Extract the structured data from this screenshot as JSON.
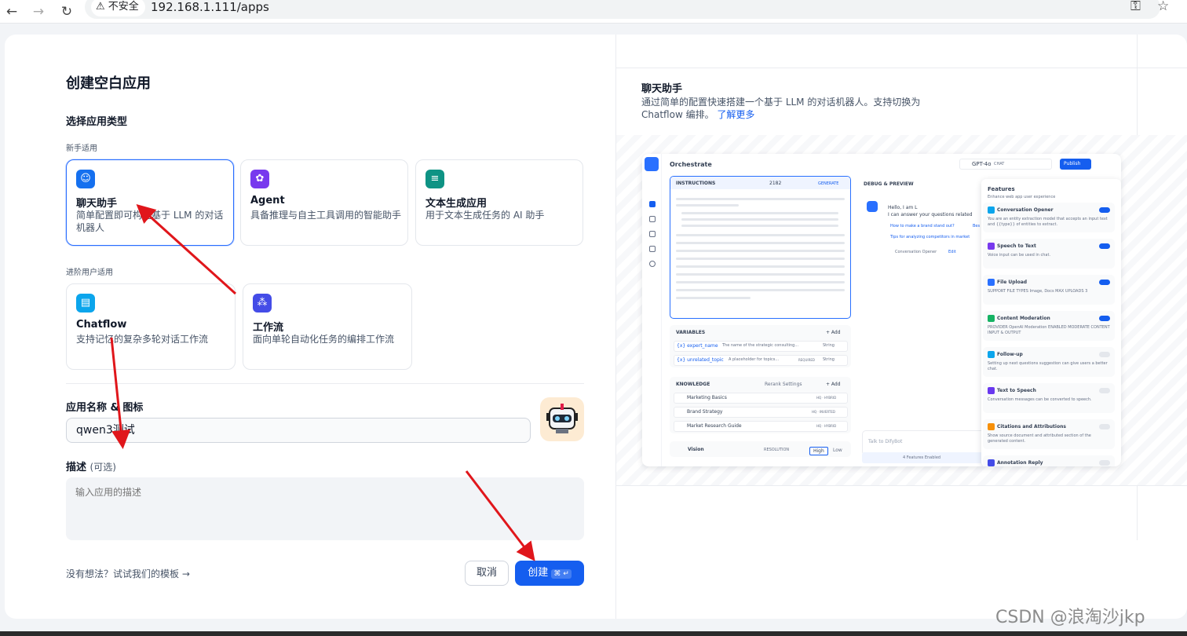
{
  "browser": {
    "security_label": "不安全",
    "url": "192.168.1.111/apps"
  },
  "modal": {
    "title": "创建空白应用",
    "type_section": "选择应用类型",
    "beginner_label": "新手适用",
    "advanced_label": "进阶用户适用",
    "cards": [
      {
        "title": "聊天助手",
        "desc": "简单配置即可构建基于 LLM 的对话机器人",
        "icon": "chat-bot-icon",
        "color": "#1570ef",
        "selected": true
      },
      {
        "title": "Agent",
        "desc": "具备推理与自主工具调用的智能助手",
        "icon": "agent-icon",
        "color": "#7839ee",
        "selected": false
      },
      {
        "title": "文本生成应用",
        "desc": "用于文本生成任务的 AI 助手",
        "icon": "text-generation-icon",
        "color": "#0e9384",
        "selected": false
      },
      {
        "title": "Chatflow",
        "desc": "支持记忆的复杂多轮对话工作流",
        "icon": "chatflow-icon",
        "color": "#0ba5ec",
        "selected": false
      },
      {
        "title": "工作流",
        "desc": "面向单轮自动化任务的编排工作流",
        "icon": "workflow-icon",
        "color": "#444ce7",
        "selected": false
      }
    ],
    "name_label": "应用名称 & 图标",
    "name_value": "qwen3测试",
    "desc_label": "描述",
    "desc_optional": "(可选)",
    "desc_placeholder": "输入应用的描述",
    "template_link": "没有想法？试试我们的模板 →",
    "cancel": "取消",
    "create": "创建",
    "create_shortcut": "⌘ ↵"
  },
  "preview": {
    "title": "聊天助手",
    "desc": "通过简单的配置快速搭建一个基于 LLM 的对话机器人。支持切换为 Chatflow 编排。",
    "learn_more": "了解更多",
    "header": "Orchestrate",
    "model": "GPT-4o",
    "model_tag": "CHAT",
    "publish": "Publish",
    "instructions": "INSTRUCTIONS",
    "count": "2182",
    "generate": "GENERATE",
    "debug": "DEBUG & PREVIEW",
    "hello": "Hello, I am L",
    "answer": "I can answer your questions related",
    "suggest1": "How to make a brand stand out?",
    "suggest1b": "Bes",
    "suggest2": "Tips for analyzing competitors in market",
    "opener": "Conversation Opener",
    "edit": "Edit",
    "talk": "Talk to DifyBot",
    "features_enabled": "4 Features Enabled",
    "variables": "VARIABLES",
    "add": "+ Add",
    "var1": "{x} expert_name",
    "var1_desc": "The name of the strategic consulting...",
    "var1_type": "String",
    "var2": "{x} unrelated_topic",
    "var2_desc": "A placeholder for topics...",
    "var2_req": "REQUIRED",
    "var2_type": "String",
    "knowledge": "KNOWLEDGE",
    "rerank": "Rerank Settings",
    "kb": [
      {
        "name": "Marketing Basics",
        "tag": "HQ · HYBRID"
      },
      {
        "name": "Brand Strategy",
        "tag": "HQ · INVERTED"
      },
      {
        "name": "Market Research Guide",
        "tag": "HQ · HYBRID"
      }
    ],
    "vision": "Vision",
    "resolution": "RESOLUTION",
    "high": "High",
    "low": "Low",
    "features_title": "Features",
    "features_sub": "Enhance web app user experience",
    "features": [
      {
        "name": "Conversation Opener",
        "desc": "You are an entity extraction model that accepts an input text and {{type}} of entities to extract.",
        "on": true,
        "color": "#0ba5ec"
      },
      {
        "name": "Speech to Text",
        "desc": "Voice input can be used in chat.",
        "on": true,
        "color": "#7839ee"
      },
      {
        "name": "File Upload",
        "desc": "SUPPORT FILE TYPES Image, Docs   MAX UPLOADS 3",
        "on": true,
        "color": "#2970ff"
      },
      {
        "name": "Content Moderation",
        "desc": "PROVIDER OpenAI Moderation   ENABLED MODERATE CONTENT INPUT & OUTPUT",
        "on": true,
        "color": "#16b364"
      },
      {
        "name": "Follow-up",
        "desc": "Setting up next questions suggestion can give users a better chat.",
        "on": false,
        "color": "#0ba5ec"
      },
      {
        "name": "Text to Speech",
        "desc": "Conversation messages can be converted to speech.",
        "on": false,
        "color": "#6938ef"
      },
      {
        "name": "Citations and Attributions",
        "desc": "Show source document and attributed section of the generated content.",
        "on": false,
        "color": "#f79009"
      },
      {
        "name": "Annotation Reply",
        "desc": "",
        "on": false,
        "color": "#444ce7"
      }
    ]
  },
  "watermark": "CSDN @浪淘沙jkp",
  "colors": {
    "primary": "#155eef",
    "annotation_arrow": "#e0161b"
  }
}
